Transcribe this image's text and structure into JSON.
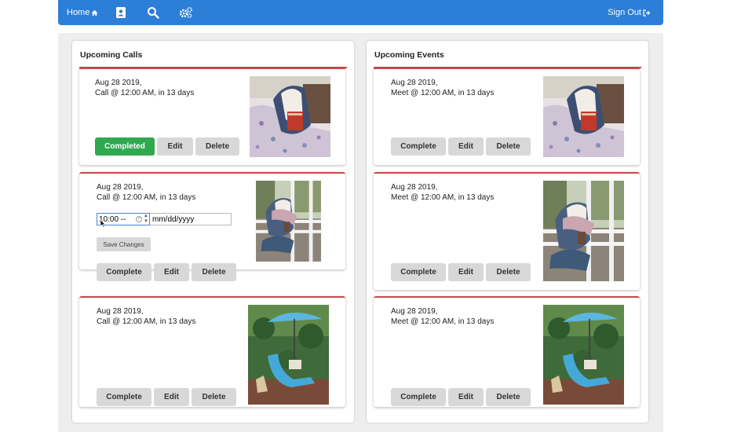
{
  "nav": {
    "home_label": "Home",
    "home_icon": "home-icon",
    "contacts_icon": "contacts-icon",
    "search_icon": "search-icon",
    "settings_icon": "gears-icon",
    "signout_label": "Sign Out",
    "signout_icon": "sign-out-icon"
  },
  "calls": {
    "title": "Upcoming Calls",
    "cards": [
      {
        "date": "Aug 28 2019,",
        "detail": "Call @ 12:00 AM, in 13 days",
        "buttons": [
          "Completed",
          "Edit",
          "Delete"
        ]
      },
      {
        "date": "Aug 28 2019,",
        "detail": "Call @ 12:00 AM, in 13 days",
        "time_value": "10:00 --",
        "date_placeholder": "mm/dd/yyyy",
        "save_label": "Save Changes",
        "buttons": [
          "Complete",
          "Edit",
          "Delete"
        ]
      },
      {
        "date": "Aug 28 2019,",
        "detail": "Call @ 12:00 AM, in 13 days",
        "buttons": [
          "Complete",
          "Edit",
          "Delete"
        ]
      }
    ]
  },
  "events": {
    "title": "Upcoming Events",
    "cards": [
      {
        "date": "Aug 28 2019,",
        "detail": "Meet @ 12:00 AM, in 13 days",
        "buttons": [
          "Complete",
          "Edit",
          "Delete"
        ]
      },
      {
        "date": "Aug 28 2019,",
        "detail": "Meet @ 12:00 AM, in 13 days",
        "buttons": [
          "Complete",
          "Edit",
          "Delete"
        ]
      },
      {
        "date": "Aug 28 2019,",
        "detail": "Meet @ 12:00 AM, in 13 days",
        "buttons": [
          "Complete",
          "Edit",
          "Delete"
        ]
      }
    ]
  },
  "colors": {
    "navbar": "#2d7ed6",
    "accent_rule": "#c64a4a",
    "completed_button": "#2fa84f",
    "button": "#d8d8d8"
  }
}
